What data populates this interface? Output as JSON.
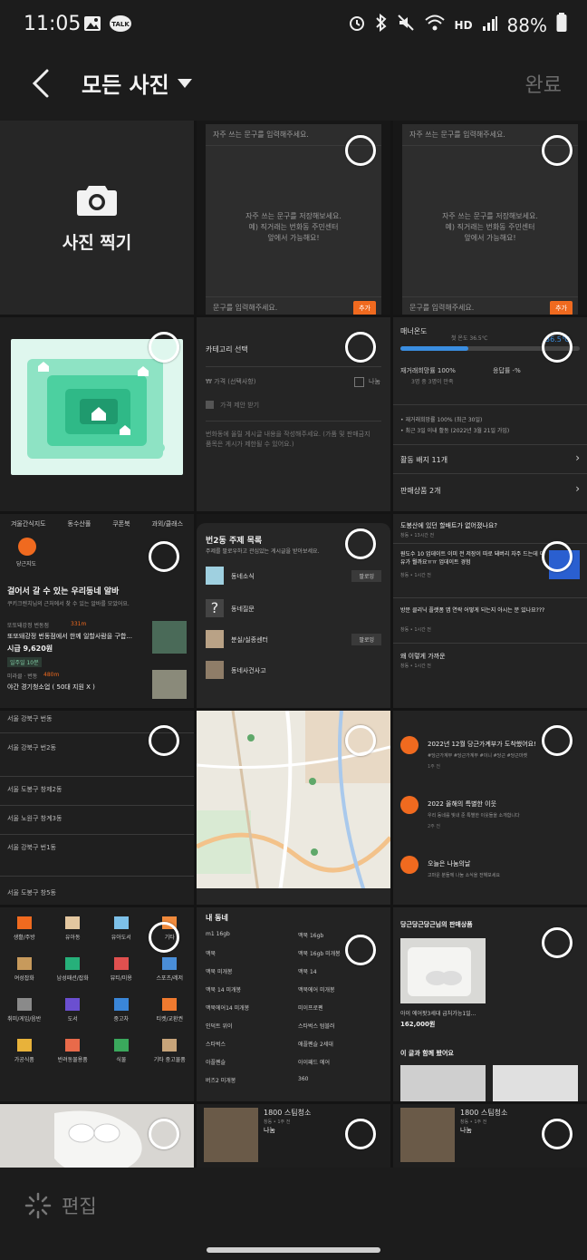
{
  "status": {
    "time": "11:05",
    "battery": "88%",
    "hd": "HD"
  },
  "header": {
    "title": "모든 사진",
    "done": "완료"
  },
  "camera": {
    "label": "사진 찍기"
  },
  "cells": {
    "note1": {
      "top": "자주 쓰는 문구를 입력해주세요.",
      "body": "자주 쓰는 문구를 저장해보세요.\n예) 직거래는 번화동 주민센터\n앞에서 가능해요!",
      "input": "문구를 입력해주세요.",
      "btn": "추가"
    },
    "note2": {
      "top": "자주 쓰는 문구를 입력해주세요.",
      "body": "자주 쓰는 문구를 저장해보세요.\n예) 직거래는 번화동 주민센터\n앞에서 가능해요!",
      "input": "문구를 입력해주세요.",
      "btn": "추가"
    },
    "form": {
      "category": "카테고리 선택",
      "price": "₩ 가격 (선택사항)",
      "share": "나눔",
      "offer": "가격 제안 받기",
      "desc": "번화동에 올릴 게시글 내용을 작성해주세요. (가품 및 판매금지 품목은 게시가 제한될 수 있어요.)"
    },
    "manner": {
      "title": "매너온도",
      "first": "첫 온도 36.5℃",
      "temp": "36.5℃",
      "a": "재거래희망률 100%",
      "a2": "3명 중 3명이 만족",
      "b": "응답률 -%",
      "r1": "• 재거래희망률 100% (최근 30일)",
      "r2": "• 최근 3일 이내 활동 (2022년 3월 21일 가입)",
      "badge": "활동 배지 11개",
      "sales": "판매상품 2개"
    },
    "community": {
      "q1": "도봉산에 있던 할배트가 없어졌나요?",
      "m1": "창동 • 13시간 전",
      "q2": "원도수 10 업데이트 이미 전 저장이 따로 돼버리 자주 드는데 이유가 뭘까요ㅠㅠ 업데이트 경험",
      "m2": "창동 • 1시간 전",
      "q3": "방문 클리닉 플랫폼 앱 연락 어떻게 되는지 아시는 분 있나요???",
      "m3": "창동 • 1시간 전",
      "q4": "왜 이렇게 가까운",
      "m4": "창동 • 1시간 전"
    },
    "topics": {
      "heading": "번2동 주제 목록",
      "sub": "주제를 팔로우하고 관심있는 게시글을 받아보세요.",
      "t1": "동네소식",
      "t2": "동네질문",
      "t3": "분실/실종센터",
      "t4": "동네사건사고",
      "follow": "팔로잉"
    },
    "alba": {
      "cats": [
        "겨울간식지도",
        "동수산풀",
        "쿠폰북",
        "과외/클래스"
      ],
      "nearby": "당근지도",
      "heading": "걸어서 갈 수 있는 우리동네 알바",
      "sub": "쿠키크렌치님의 근처에서 찾 수 있는 알바를 모았어요.",
      "j1": "또또돼강정 번동점",
      "j1t": "또또돼강정 번동점에서 한께 일할사람을 구합...",
      "j1p": "시급 9,620원",
      "j1s": "일주일 10분",
      "j2": "미라클 · 번동",
      "j2t": "야간 경기청소업 ( 50대 지원 X )",
      "dist1": "331m",
      "dist2": "480m"
    },
    "places": [
      "서울 강북구 번동",
      "서울 강북구 번2동",
      "서울 도봉구 창제2동",
      "서울 노원구 창계3동",
      "서울 강북구 번1동",
      "서울 도봉구 창5동"
    ],
    "catgrid": [
      "생활/주방",
      "유아동",
      "유아도서",
      "기타",
      "여성잡화",
      "남성패션/잡화",
      "뷰티/미용",
      "스포츠/레저",
      "취미/게임/음반",
      "도서",
      "중고차",
      "티켓/교환권",
      "가공식품",
      "반려동물용품",
      "식물",
      "기타 중고물품"
    ],
    "search": {
      "heading": "내 동네",
      "rows": [
        [
          "m1 16gb",
          "맥북 16gb"
        ],
        [
          "맥북",
          "맥북 16gb 미개봉"
        ],
        [
          "맥북 미개봉",
          "맥북 14"
        ],
        [
          "맥북 14 미개봉",
          "맥북에어 미개봉"
        ],
        [
          "맥북에어14 미개봉",
          "미이프로펜"
        ],
        [
          "인덕트 위이",
          "스타벅스 텀블러"
        ],
        [
          "스타벅스",
          "애플펜슬 2세대"
        ],
        [
          "아플펜슬",
          "아이패드 에어"
        ],
        [
          "버즈2 미개봉",
          "360"
        ]
      ]
    },
    "notify": {
      "n1": "2022년 12월 당근가계부가 도착했어요!",
      "n1s": "#당근가계부 #당근가계부 #이니 #당근 #당근마켓",
      "n2": "2022 올해의 특별한 이웃",
      "n2s": "우리 동네를 빛내 준 특별한 이웃들을 소개합니다",
      "n3": "오늘은 나눔의날",
      "n3s": "고마운 분들께 나눔 소식을 전해보세요",
      "t1": "1주 전",
      "t2": "2주 전",
      "t3": "2주 전"
    },
    "shop": {
      "heading": "당근당근당근님의 판매상품",
      "item": "아이 에어팟3세대 급처가능1일...",
      "price": "162,000원",
      "related": "이 글과 함께 봤어요"
    },
    "listing1": {
      "title": "1800 스팀청소",
      "meta": "창동 • 1주 전",
      "tag": "나눔"
    },
    "listing2": {
      "title": "1800 스팀청소",
      "meta": "창동 • 1주 전",
      "tag": "나눔"
    }
  },
  "bottom": {
    "edit": "편집"
  },
  "colors": {
    "accent": "#f06a1f",
    "mint": "#3fd1a4",
    "bg": "#1c1c1c"
  }
}
